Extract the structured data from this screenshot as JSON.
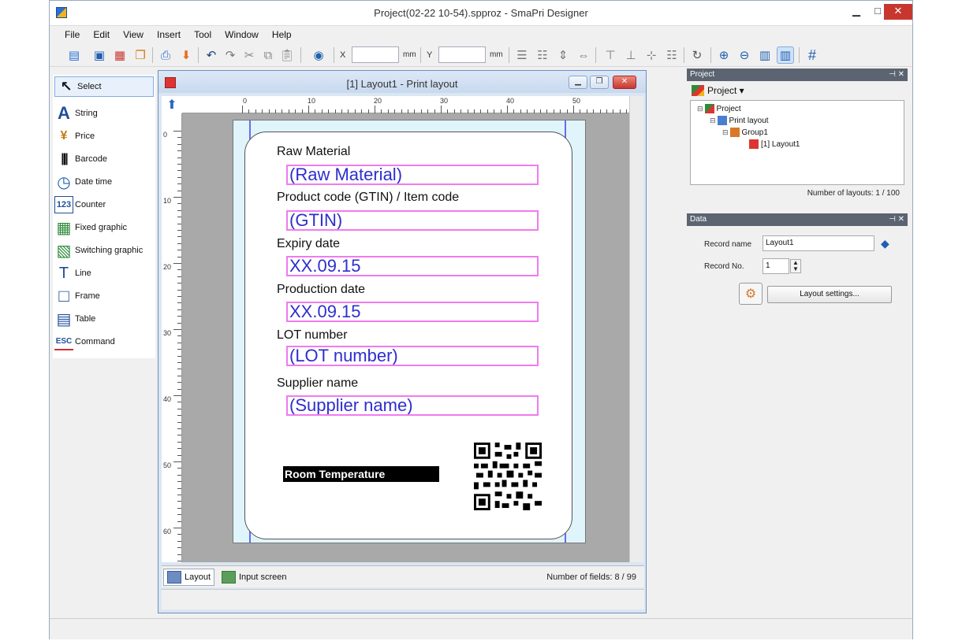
{
  "window": {
    "title": "Project(02-22 10-54).spproz - SmaPri Designer",
    "minimize_glyph": "▁",
    "maximize_glyph": "□",
    "close_glyph": "✕"
  },
  "menu": {
    "items": [
      "File",
      "Edit",
      "View",
      "Insert",
      "Tool",
      "Window",
      "Help"
    ]
  },
  "toolbar": {
    "x_label": "X",
    "y_label": "Y",
    "x_value": "",
    "y_value": "",
    "x_unit": "mm",
    "y_unit": "mm"
  },
  "toolbox": {
    "items": [
      {
        "label": "Select",
        "icon": "arrow-select-icon",
        "glyph": "↖"
      },
      {
        "label": "String",
        "icon": "string-icon",
        "glyph": "A"
      },
      {
        "label": "Price",
        "icon": "price-icon",
        "glyph": "¥"
      },
      {
        "label": "Barcode",
        "icon": "barcode-icon",
        "glyph": "|||"
      },
      {
        "label": "Date time",
        "icon": "clock-icon",
        "glyph": "◷"
      },
      {
        "label": "Counter",
        "icon": "counter-icon",
        "glyph": "123"
      },
      {
        "label": "Fixed graphic",
        "icon": "image-icon",
        "glyph": "▦"
      },
      {
        "label": "Switching graphic",
        "icon": "switch-image-icon",
        "glyph": "▧"
      },
      {
        "label": "Line",
        "icon": "line-icon",
        "glyph": "T"
      },
      {
        "label": "Frame",
        "icon": "frame-icon",
        "glyph": "□"
      },
      {
        "label": "Table",
        "icon": "table-icon",
        "glyph": "▤"
      },
      {
        "label": "Command",
        "icon": "esc-command-icon",
        "glyph": "ESC"
      }
    ]
  },
  "layout_window": {
    "title": "[1] Layout1 - Print layout",
    "ruler_h": [
      "0",
      "10",
      "20",
      "30",
      "40",
      "50"
    ],
    "ruler_v": [
      "0",
      "10",
      "20",
      "30",
      "40",
      "50",
      "60"
    ],
    "tabs": [
      {
        "label": "Layout",
        "active": true
      },
      {
        "label": "Input screen",
        "active": false
      }
    ],
    "fields_count": "Number of fields: 8 / 99"
  },
  "label": {
    "fields": [
      {
        "title": "Raw Material",
        "value": "(Raw Material)"
      },
      {
        "title": "Product code (GTIN) / Item code",
        "value": "(GTIN)"
      },
      {
        "title": "Expiry date",
        "value": "XX.09.15"
      },
      {
        "title": "Production date",
        "value": "XX.09.15"
      },
      {
        "title": "LOT number",
        "value": "(LOT number)"
      },
      {
        "title": "Supplier name",
        "value": "(Supplier name)"
      }
    ],
    "room_temperature": "Room Temperature",
    "field_border_color": "#f07bf0",
    "field_text_color": "#2e2ecf"
  },
  "project_panel": {
    "header": "Project",
    "toolbar_label": "Project ▾",
    "tree": [
      {
        "label": "Project",
        "level": 0
      },
      {
        "label": "Print layout",
        "level": 1
      },
      {
        "label": "Group1",
        "level": 2
      },
      {
        "label": "[1] Layout1",
        "level": 3
      }
    ],
    "layouts_count": "Number of layouts: 1 / 100"
  },
  "data_panel": {
    "header": "Data",
    "record_name_label": "Record name",
    "record_name_value": "Layout1",
    "record_no_label": "Record No.",
    "record_no_value": "1",
    "layout_settings_label": "Layout settings..."
  }
}
